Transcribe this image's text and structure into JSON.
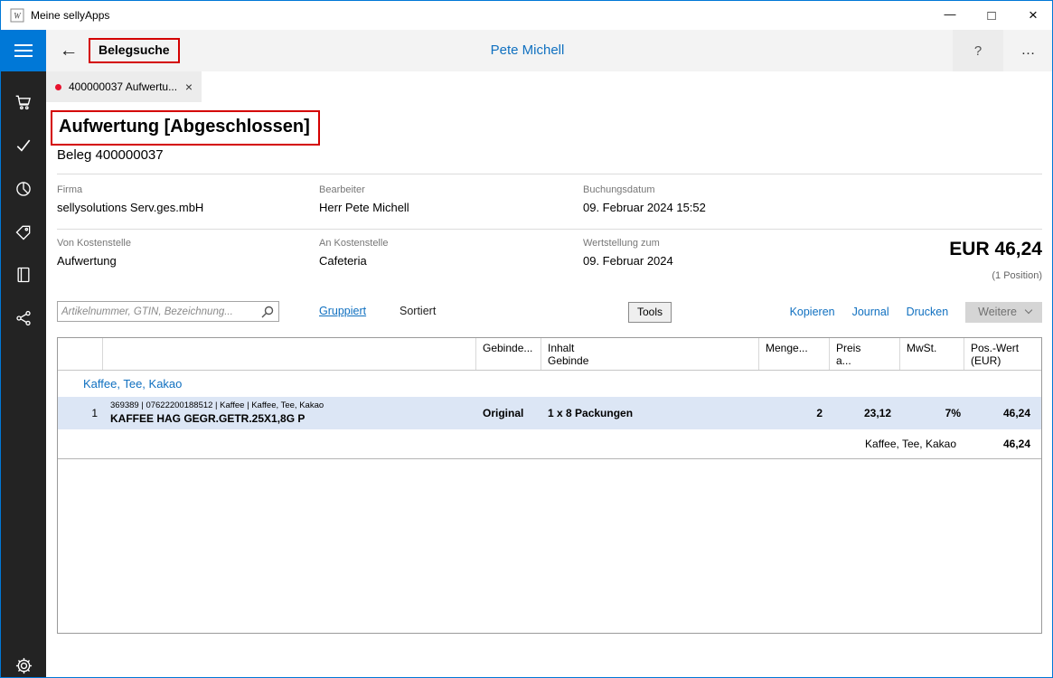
{
  "window": {
    "title": "Meine sellyApps",
    "minimize_icon": "—",
    "maximize_icon": "□",
    "close_icon": "×"
  },
  "header": {
    "back_icon": "←",
    "back_label": "Belegsuche",
    "user_name": "Pete Michell",
    "help_icon": "?",
    "more_icon": "…"
  },
  "sidebar": {
    "icons": [
      "menu-icon",
      "cart-icon",
      "check-icon",
      "pie-chart-icon",
      "price-tag-icon",
      "ledger-icon",
      "share-icon",
      "gear-icon"
    ]
  },
  "tab": {
    "label": "400000037 Aufwertu...",
    "close_icon": "×"
  },
  "doc": {
    "title": "Aufwertung [Abgeschlossen]",
    "subtitle": "Beleg 400000037",
    "fields": [
      {
        "label": "Firma",
        "value": "sellysolutions Serv.ges.mbH"
      },
      {
        "label": "Bearbeiter",
        "value": "Herr Pete Michell"
      },
      {
        "label": "Buchungsdatum",
        "value": "09. Februar 2024 15:52"
      },
      {
        "label": "Von Kostenstelle",
        "value": "Aufwertung"
      },
      {
        "label": "An Kostenstelle",
        "value": "Cafeteria"
      },
      {
        "label": "Wertstellung zum",
        "value": "09. Februar 2024"
      }
    ],
    "total_amount": "EUR 46,24",
    "total_note": "(1 Position)"
  },
  "toolbar": {
    "search_placeholder": "Artikelnummer, GTIN, Bezeichnung...",
    "gruppiert_label": "Gruppiert",
    "sortiert_label": "Sortiert",
    "tools_label": "Tools",
    "kopieren_label": "Kopieren",
    "journal_label": "Journal",
    "drucken_label": "Drucken",
    "weitere_label": "Weitere"
  },
  "table": {
    "headers": [
      {
        "l1": "",
        "l2": ""
      },
      {
        "l1": "",
        "l2": ""
      },
      {
        "l1": "Gebinde...",
        "l2": ""
      },
      {
        "l1": "Inhalt",
        "l2": "Gebinde"
      },
      {
        "l1": "Menge...",
        "l2": ""
      },
      {
        "l1": "Preis",
        "l2": "a..."
      },
      {
        "l1": "MwSt.",
        "l2": ""
      },
      {
        "l1": "Pos.-Wert",
        "l2": "(EUR)"
      }
    ],
    "group_label": "Kaffee, Tee, Kakao",
    "rows": [
      {
        "pos": "1",
        "meta": "369389 | 07622200188512 | Kaffee | Kaffee, Tee, Kakao",
        "name": "KAFFEE HAG GEGR.GETR.25X1,8G P",
        "gebinde": "Original",
        "inhalt": "1 x 8 Packungen",
        "menge": "2",
        "preis": "23,12",
        "mwst": "7%",
        "wert": "46,24"
      }
    ],
    "summary": {
      "label": "Kaffee, Tee, Kakao",
      "value": "46,24"
    }
  },
  "colors": {
    "accent": "#0078d7",
    "link": "#1070c0",
    "annotation": "#d40000",
    "row_highlight": "#dce6f5",
    "sidebar_bg": "#232323"
  }
}
